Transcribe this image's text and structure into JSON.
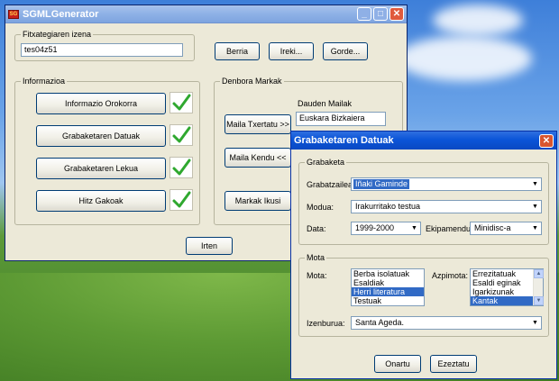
{
  "main_window": {
    "title": "SGMLGenerator",
    "file_group": {
      "legend": "Fitxategiaren izena",
      "filename_value": "tes04z51",
      "new_label": "Berria",
      "open_label": "Ireki...",
      "save_label": "Gorde..."
    },
    "info_group": {
      "legend": "Informazioa",
      "buttons": [
        "Informazio Orokorra",
        "Grabaketaren Datuak",
        "Grabaketaren Lekua",
        "Hitz Gakoak"
      ]
    },
    "tags_group": {
      "legend": "Denbora Markak",
      "available_label": "Dauden Mailak",
      "available_value": "Euskara Bizkaiera",
      "mark_label": "Maila Txertatu >>",
      "remove_label": "Maila Kendu <<",
      "show_label": "Markak Ikusi"
    },
    "exit_label": "Irten"
  },
  "dialog": {
    "title": "Grabaketaren Datuak",
    "recording_group": {
      "legend": "Grabaketa",
      "recorder_label": "Grabatzailea:",
      "recorder_value": "Iñaki Gaminde",
      "mode_label": "Modua:",
      "mode_value": "Irakurritako testua",
      "date_label": "Data:",
      "date_value": "1999-2000",
      "equipment_label": "Ekipamendua:",
      "equipment_value": "Minidisc-a"
    },
    "type_group": {
      "legend": "Mota",
      "type_label": "Mota:",
      "type_items": [
        "Berba isolatuak",
        "Esaldiak",
        "Herri literatura",
        "Testuak"
      ],
      "type_selected": 2,
      "subtype_label": "Azpimota:",
      "subtype_items": [
        "Errezitatuak",
        "Esaldi eginak",
        "Igarkizunak",
        "Kantak"
      ],
      "subtype_selected": 3,
      "title_label": "Izenburua:",
      "title_value": "Santa Ageda."
    },
    "ok_label": "Onartu",
    "cancel_label": "Ezeztatu"
  },
  "colors": {
    "selection": "#316ac5",
    "check": "#2fa82f",
    "close_button": "#d8552f"
  }
}
